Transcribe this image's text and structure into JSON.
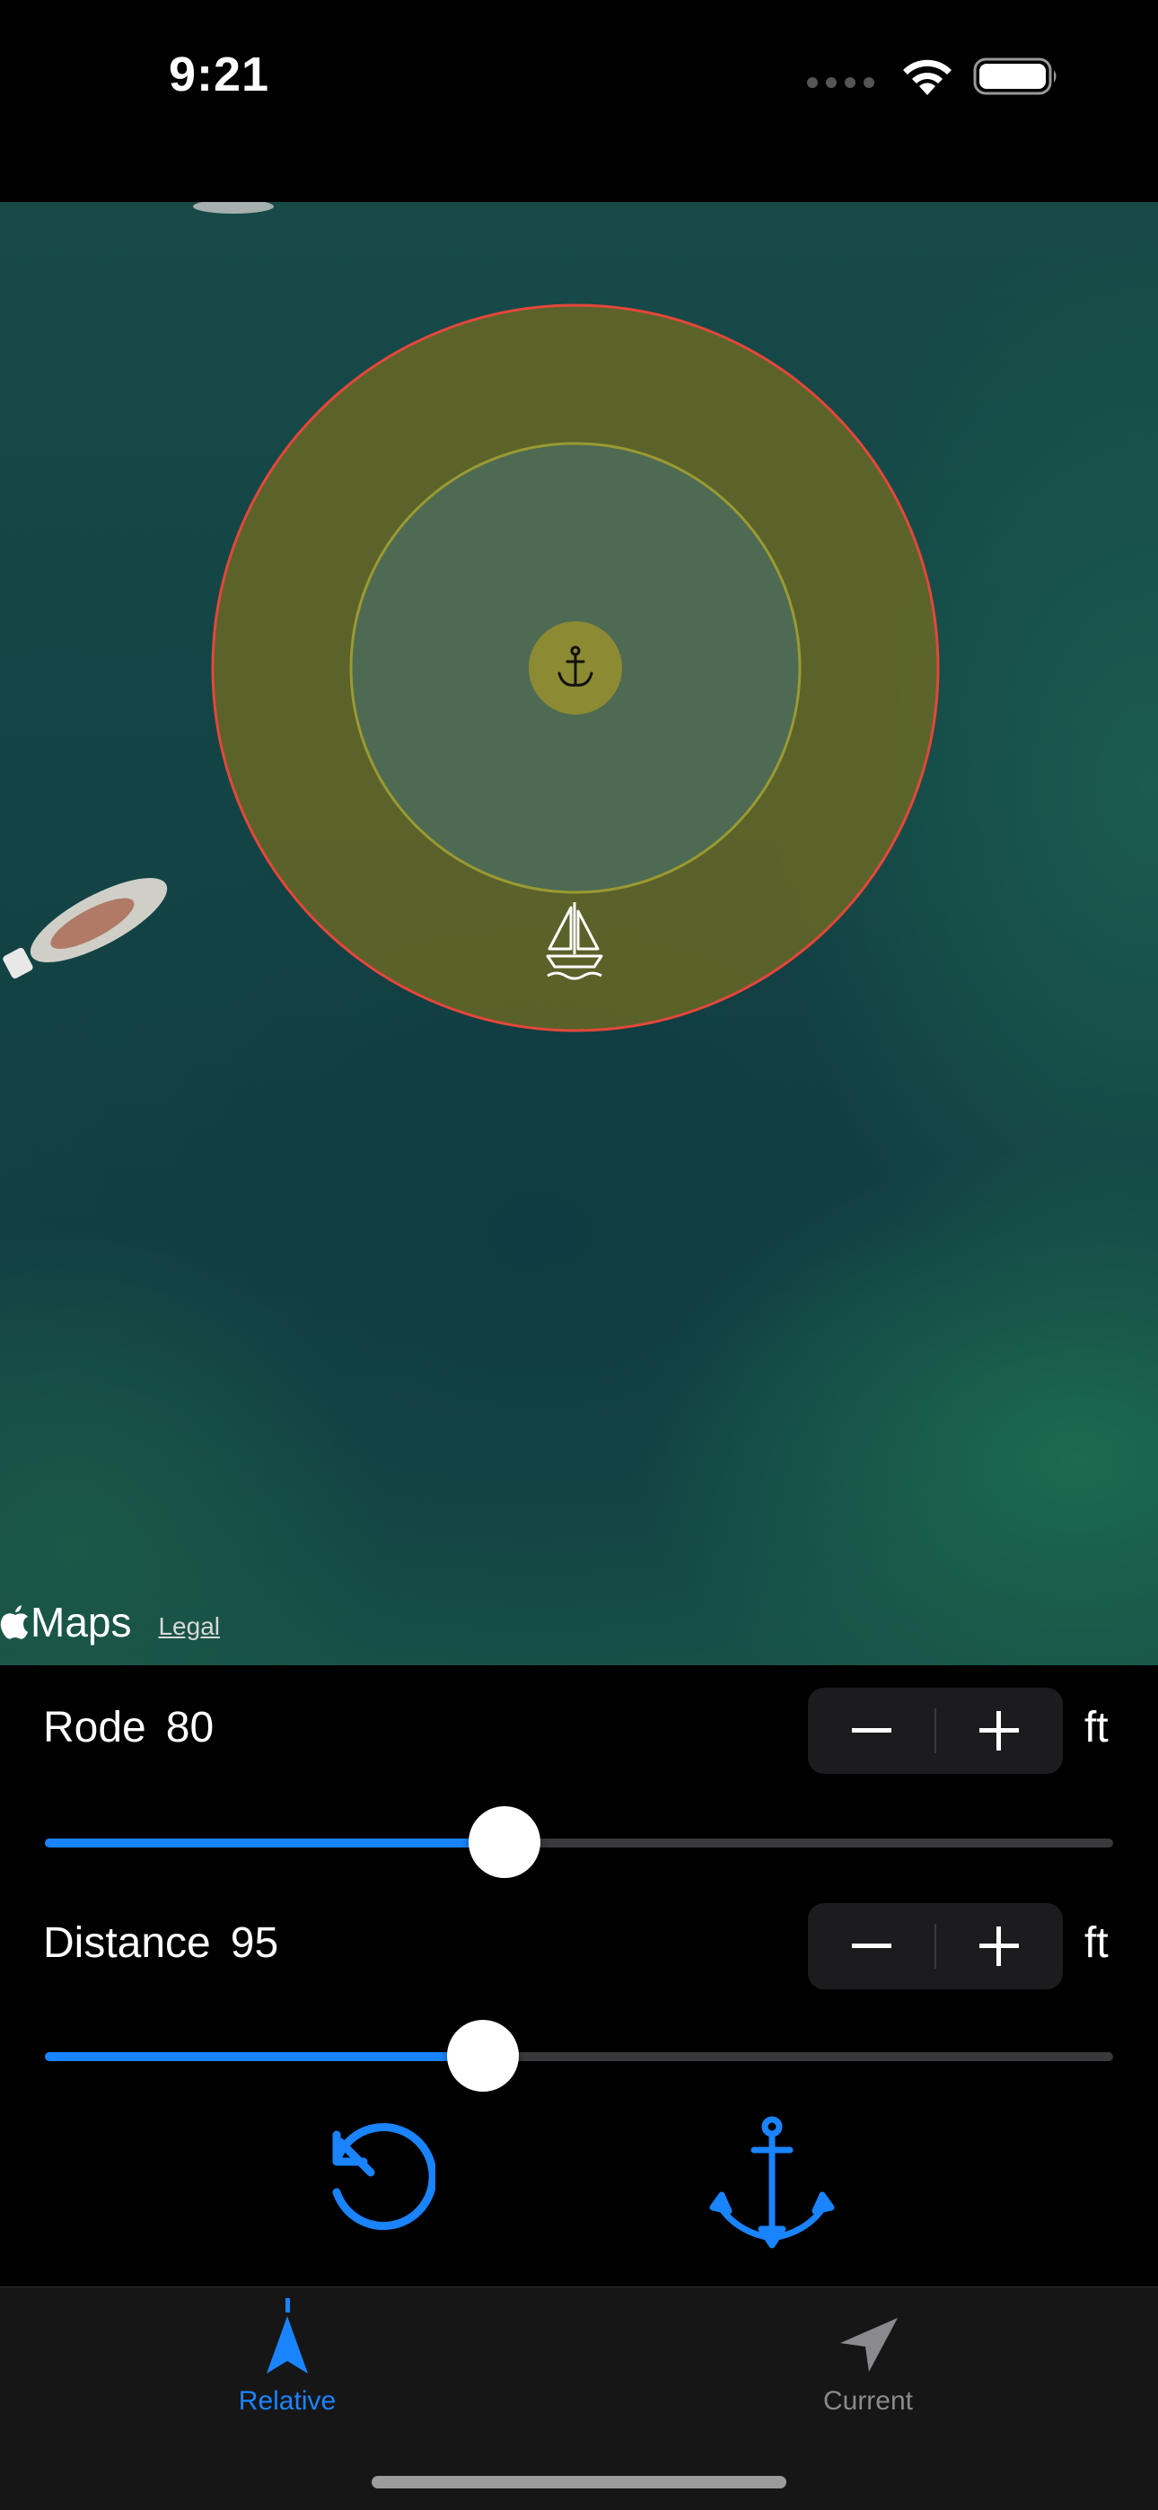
{
  "status_bar": {
    "time": "9:21",
    "icons": [
      "signal-icon",
      "wifi-icon",
      "battery-icon"
    ]
  },
  "map": {
    "brand": "Maps",
    "legal": "Legal",
    "rings": {
      "outer_color": "#e4473a",
      "inner_color": "#8f8f2e",
      "fill_color": "#6b6b24"
    },
    "markers": [
      "anchor-icon",
      "sailboat-icon"
    ]
  },
  "rode": {
    "label": "Rode",
    "value": "80",
    "unit": "ft",
    "minus": "−",
    "plus": "+",
    "slider_fraction": 0.43
  },
  "distance": {
    "label": "Distance",
    "value": "95",
    "unit": "ft",
    "minus": "−",
    "plus": "+",
    "slider_fraction": 0.41
  },
  "actions": [
    "reset-icon",
    "anchor-drop-icon"
  ],
  "tabs": [
    {
      "label": "Relative",
      "active": true,
      "icon": "relative-arrow-icon"
    },
    {
      "label": "Current",
      "active": false,
      "icon": "location-arrow-icon"
    }
  ],
  "colors": {
    "accent": "#1a84ff",
    "inactive": "#8a8a8e"
  }
}
